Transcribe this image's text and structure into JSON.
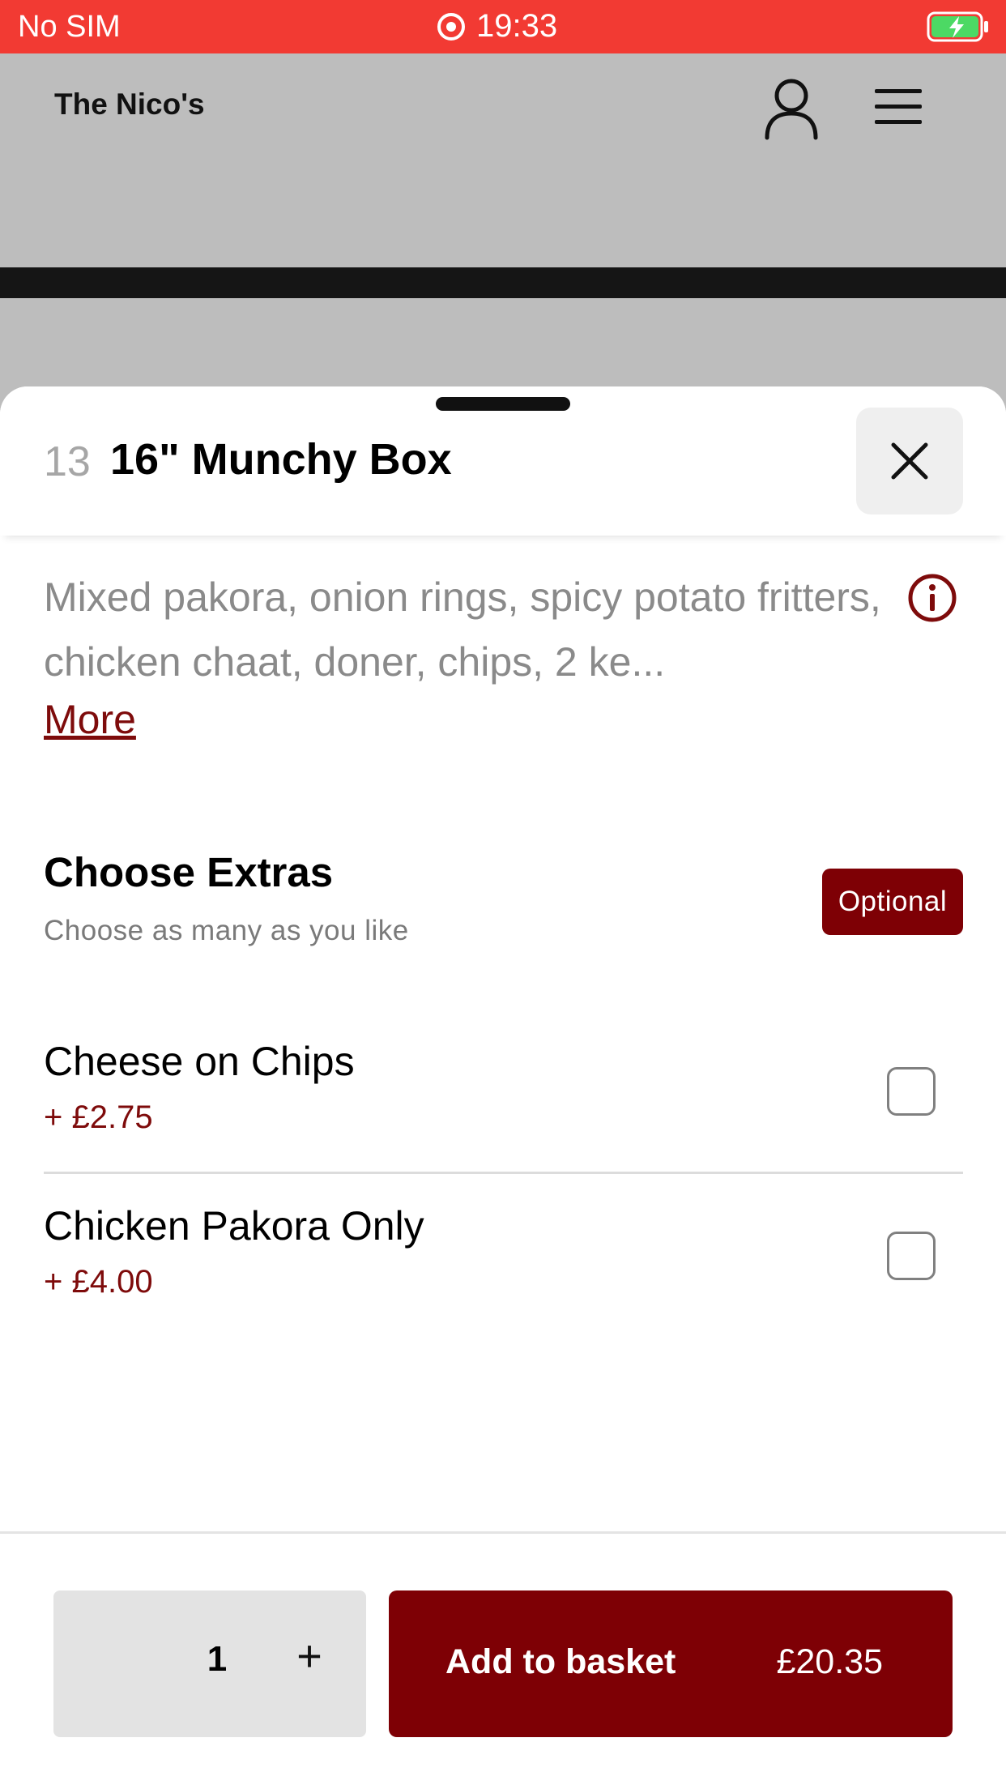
{
  "status_bar": {
    "carrier": "No SIM",
    "time": "19:33",
    "colors": {
      "background": "#f23a33",
      "battery_fill": "#4cd964"
    }
  },
  "header": {
    "title": "The Nico's",
    "icons": [
      "user-icon",
      "hamburger-menu-icon"
    ]
  },
  "item": {
    "number": "13",
    "name": "16\" Munchy Box",
    "description": "Mixed pakora, onion rings, spicy potato fritters, chicken chaat, doner, chips, 2 ke...",
    "more_label": "More"
  },
  "extras": {
    "title": "Choose Extras",
    "subtitle": "Choose as many as you like",
    "badge": "Optional",
    "options": [
      {
        "name": "Cheese on Chips",
        "price": "+ £2.75",
        "checked": false
      },
      {
        "name": "Chicken Pakora Only",
        "price": "+ £4.00",
        "checked": false
      }
    ]
  },
  "footer": {
    "quantity": "1",
    "plus_label": "+",
    "add_label": "Add to basket",
    "total": "£20.35"
  },
  "colors": {
    "accent": "#7e0005",
    "link": "#7e0b0b"
  }
}
